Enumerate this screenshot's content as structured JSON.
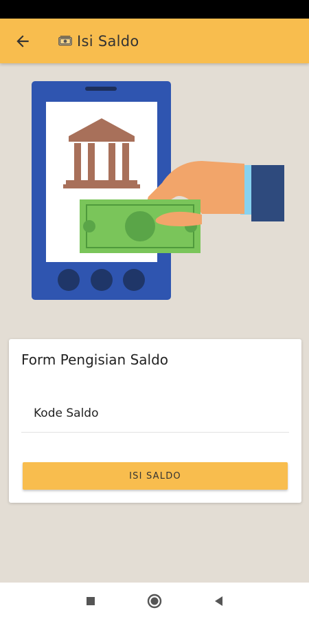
{
  "header": {
    "title": "Isi Saldo",
    "back_icon": "arrow-left-icon",
    "title_icon": "money-icon",
    "bg_color": "#f8bd4e"
  },
  "hero": {
    "icon": "mobile-top-up-illustration",
    "phone_color": "#2f55b0",
    "bank_color": "#a8705a",
    "cash_color": "#7ac55a",
    "sleeve_color": "#2e4a7d"
  },
  "form": {
    "title": "Form Pengisian Saldo",
    "kode_placeholder": "Kode Saldo",
    "submit_label": "ISI SALDO"
  },
  "navigation": {
    "recent_icon": "square-icon",
    "home_icon": "circle-icon",
    "back_icon": "triangle-back-icon"
  }
}
